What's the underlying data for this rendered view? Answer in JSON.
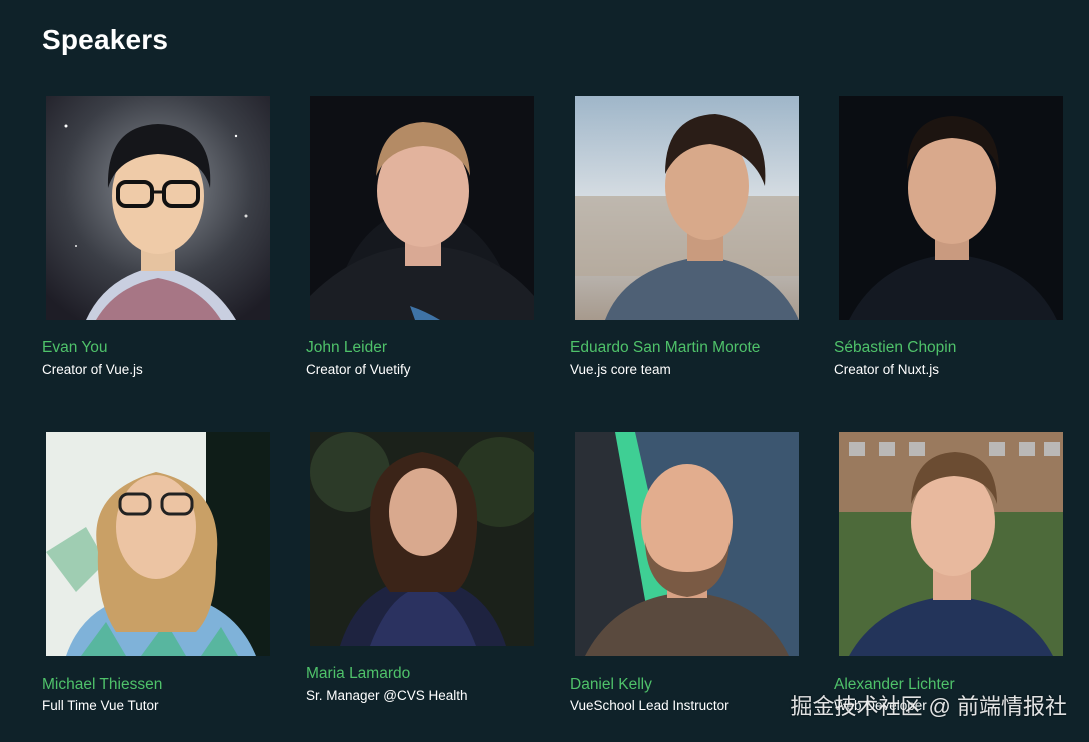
{
  "section": {
    "title": "Speakers"
  },
  "speakers": [
    {
      "name": "Evan You",
      "role": "Creator of Vue.js"
    },
    {
      "name": "John Leider",
      "role": "Creator of Vuetify"
    },
    {
      "name": "Eduardo San Martin Morote",
      "role": "Vue.js core team"
    },
    {
      "name": "Sébastien Chopin",
      "role": "Creator of Nuxt.js"
    },
    {
      "name": "Michael Thiessen",
      "role": "Full Time Vue Tutor"
    },
    {
      "name": "Maria Lamardo",
      "role": "Sr. Manager @CVS Health"
    },
    {
      "name": "Daniel Kelly",
      "role": "VueSchool Lead Instructor"
    },
    {
      "name": "Alexander Lichter",
      "role": "Web Developer"
    }
  ],
  "watermark": {
    "text": "掘金技术社区 @ 前端情报社"
  },
  "colors": {
    "background": "#0f2229",
    "name": "#4fc26a",
    "role": "#ffffff"
  }
}
